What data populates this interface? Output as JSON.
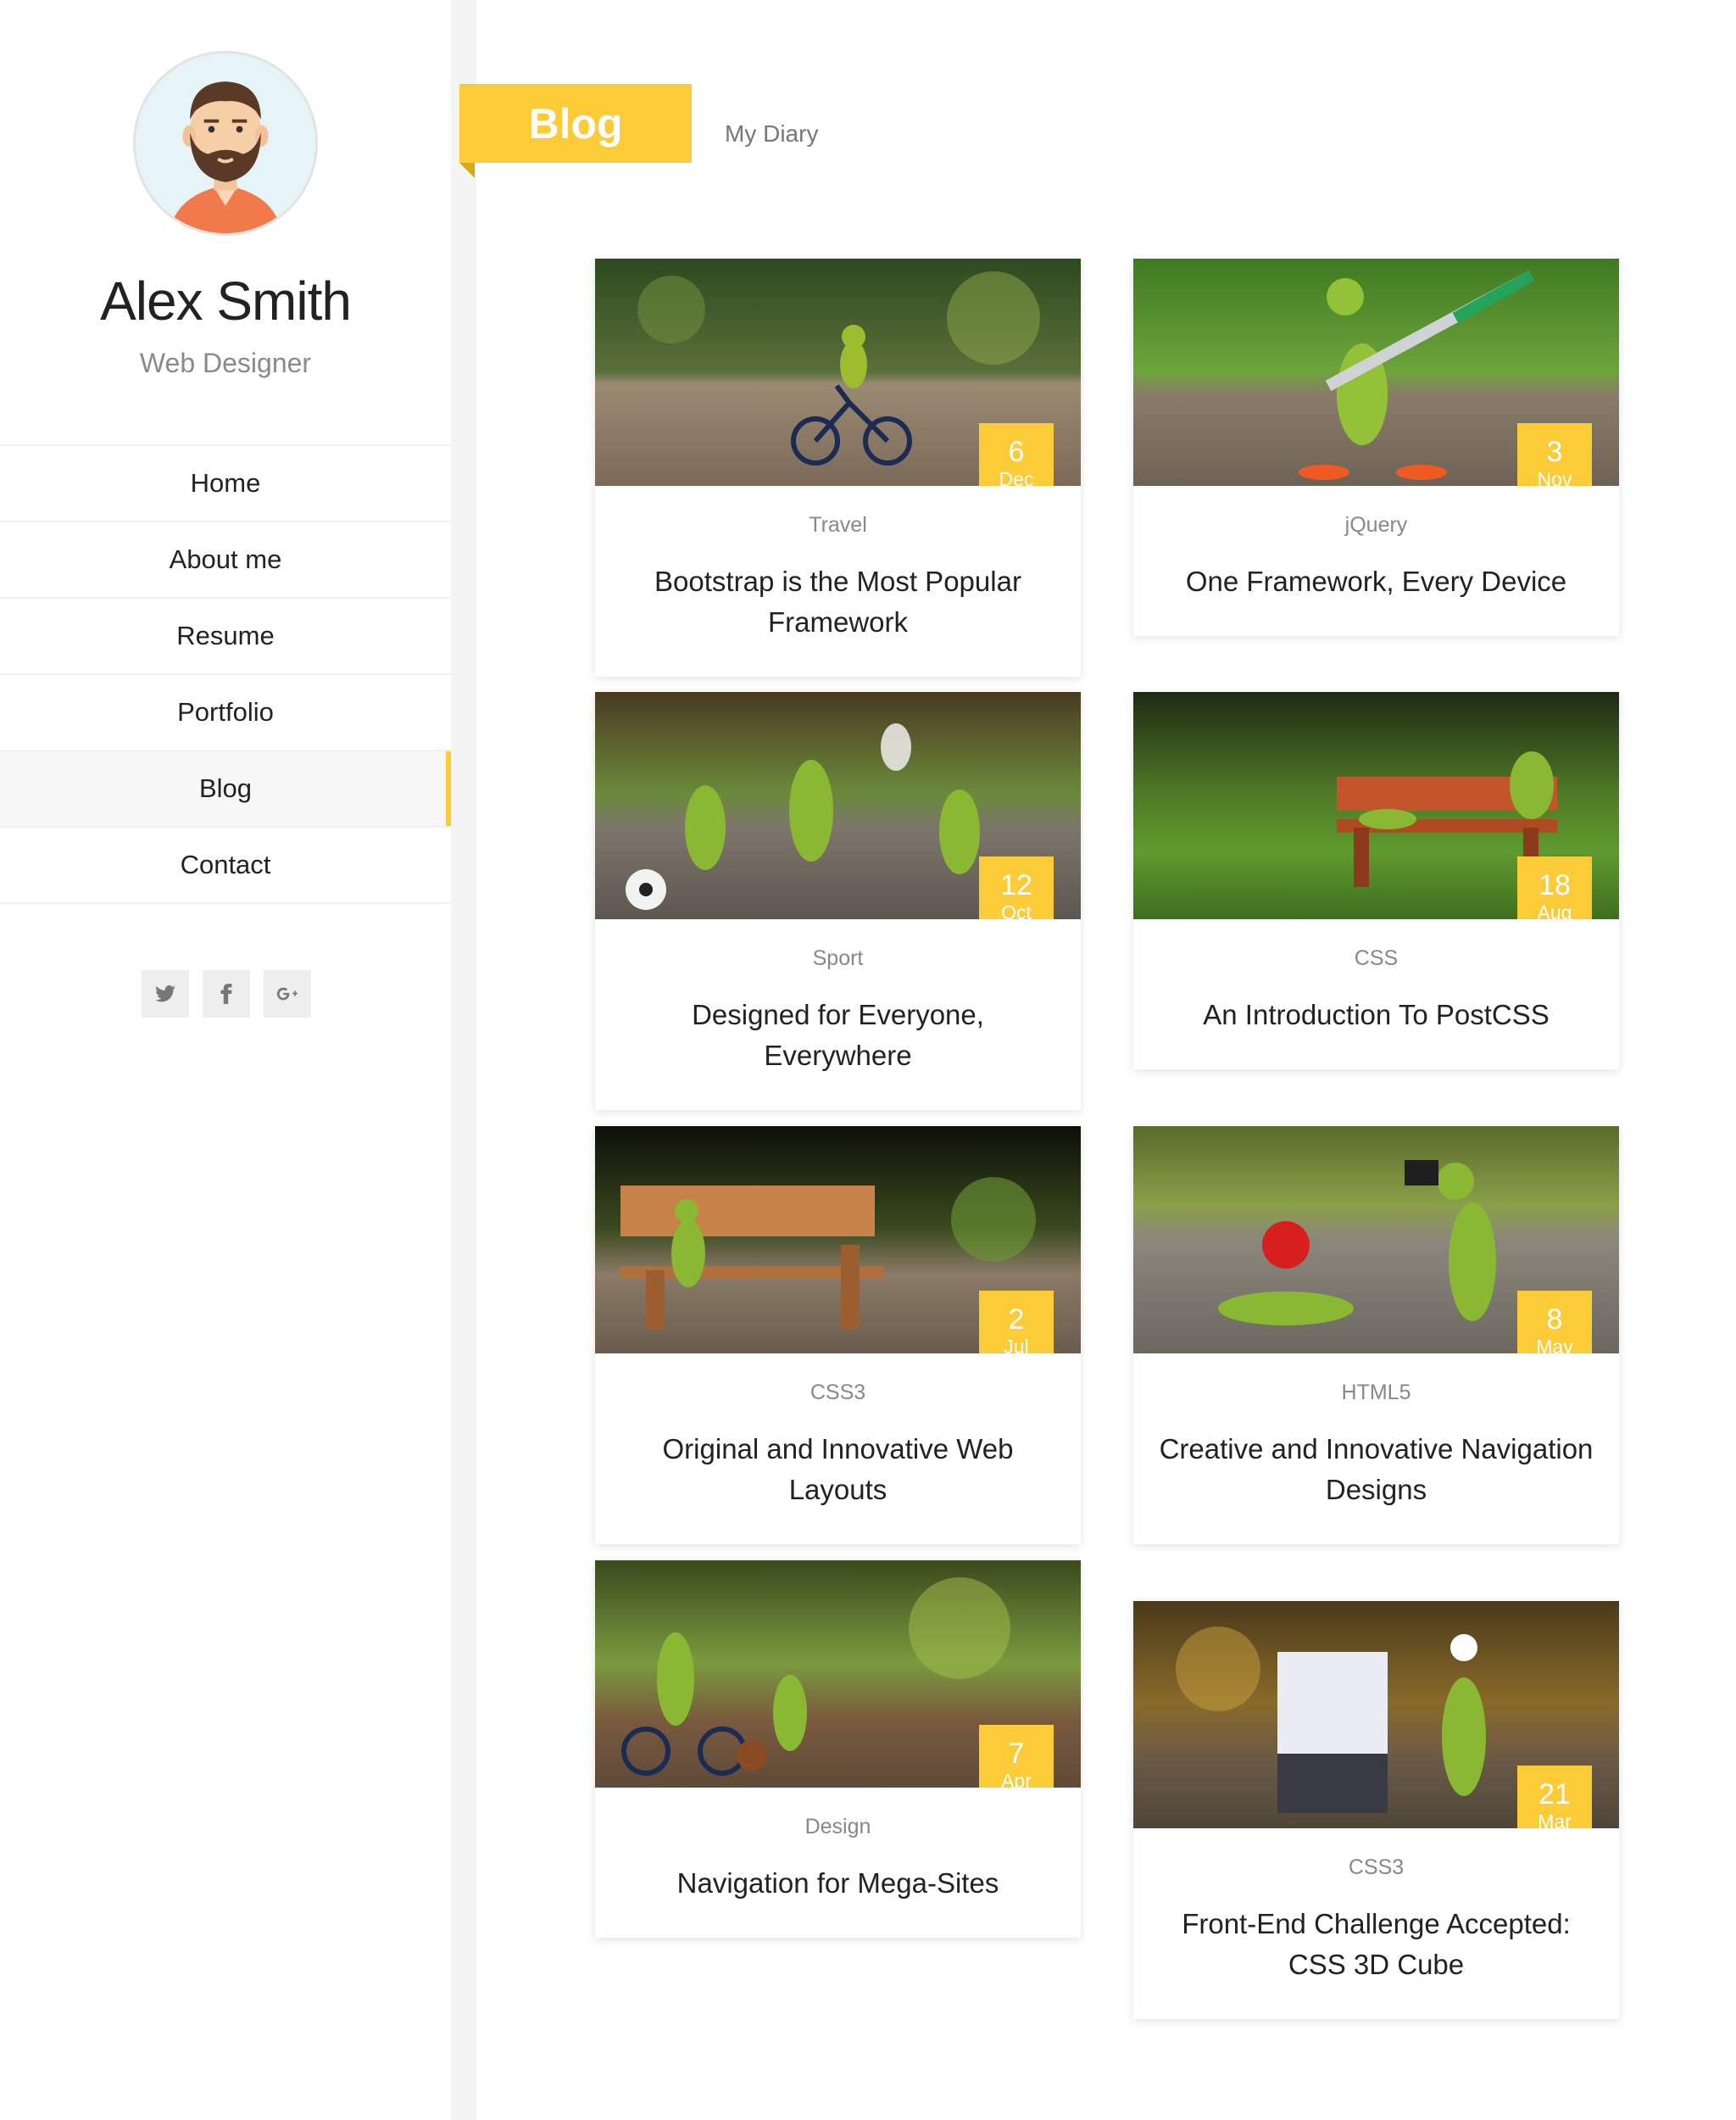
{
  "profile": {
    "name": "Alex Smith",
    "role": "Web Designer"
  },
  "nav": {
    "items": [
      {
        "label": "Home"
      },
      {
        "label": "About me"
      },
      {
        "label": "Resume"
      },
      {
        "label": "Portfolio"
      },
      {
        "label": "Blog",
        "active": true
      },
      {
        "label": "Contact"
      }
    ]
  },
  "social": [
    "twitter-icon",
    "facebook-icon",
    "google-plus-icon"
  ],
  "header": {
    "title": "Blog",
    "subtitle": "My Diary"
  },
  "posts": [
    {
      "day": "6",
      "month": "Dec",
      "category": "Travel",
      "title": "Bootstrap is the Most Popular Framework"
    },
    {
      "day": "3",
      "month": "Nov",
      "category": "jQuery",
      "title": "One Framework, Every Device"
    },
    {
      "day": "12",
      "month": "Oct",
      "category": "Sport",
      "title": "Designed for Everyone, Everywhere"
    },
    {
      "day": "18",
      "month": "Aug",
      "category": "CSS",
      "title": "An Introduction To PostCSS"
    },
    {
      "day": "2",
      "month": "Jul",
      "category": "CSS3",
      "title": "Original and Innovative Web Layouts"
    },
    {
      "day": "8",
      "month": "May",
      "category": "HTML5",
      "title": "Creative and Innovative Navigation Designs"
    },
    {
      "day": "7",
      "month": "Apr",
      "category": "Design",
      "title": "Navigation for Mega-Sites"
    },
    {
      "day": "21",
      "month": "Mar",
      "category": "CSS3",
      "title": "Front-End Challenge Accepted: CSS 3D Cube"
    }
  ],
  "colors": {
    "accent": "#fccb38"
  }
}
